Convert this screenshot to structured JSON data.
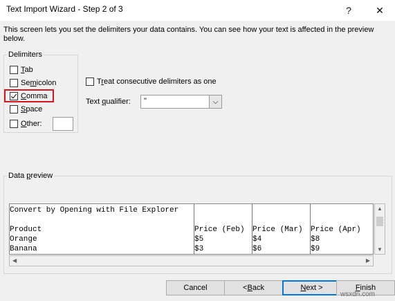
{
  "window": {
    "title": "Text Import Wizard - Step 2 of 3",
    "help_glyph": "?",
    "close_glyph": "✕"
  },
  "description": "This screen lets you set the delimiters your data contains.  You can see how your text is affected in the preview below.",
  "delimiters": {
    "legend": "Delimiters",
    "tab": {
      "first": "T",
      "rest": "ab",
      "checked": false
    },
    "semicolon": {
      "pre": "Se",
      "ul": "m",
      "rest": "icolon",
      "checked": false
    },
    "comma": {
      "ul": "C",
      "rest": "omma",
      "checked": true
    },
    "space": {
      "ul": "S",
      "rest": "pace",
      "checked": false
    },
    "other": {
      "ul": "O",
      "rest": "ther:",
      "checked": false,
      "value": ""
    }
  },
  "consecutive": {
    "pre": "T",
    "ul": "r",
    "rest": "eat consecutive delimiters as one",
    "checked": false
  },
  "qualifier": {
    "pre": "Text ",
    "ul": "q",
    "rest": "ualifier:",
    "value": "\""
  },
  "preview": {
    "legend_pre": "Data ",
    "legend_ul": "p",
    "legend_rest": "review",
    "columns": [
      {
        "cells": [
          "Convert by Opening with File Explorer",
          "",
          "Product",
          "Orange",
          "Banana"
        ]
      },
      {
        "cells": [
          "",
          "",
          "Price (Feb)",
          "$5",
          "$3"
        ]
      },
      {
        "cells": [
          "",
          "",
          "Price (Mar)",
          "$4",
          "$6"
        ]
      },
      {
        "cells": [
          "",
          "",
          "Price (Apr)",
          "$8",
          "$9"
        ]
      }
    ]
  },
  "buttons": {
    "cancel": "Cancel",
    "back": {
      "pre": "< ",
      "ul": "B",
      "rest": "ack"
    },
    "next": {
      "ul": "N",
      "rest": "ext >"
    },
    "finish": {
      "ul": "F",
      "rest": "inish"
    }
  },
  "watermark": "wsxdn.com",
  "colors": {
    "highlight": "#d6171d",
    "default_button_border": "#0078d7"
  }
}
